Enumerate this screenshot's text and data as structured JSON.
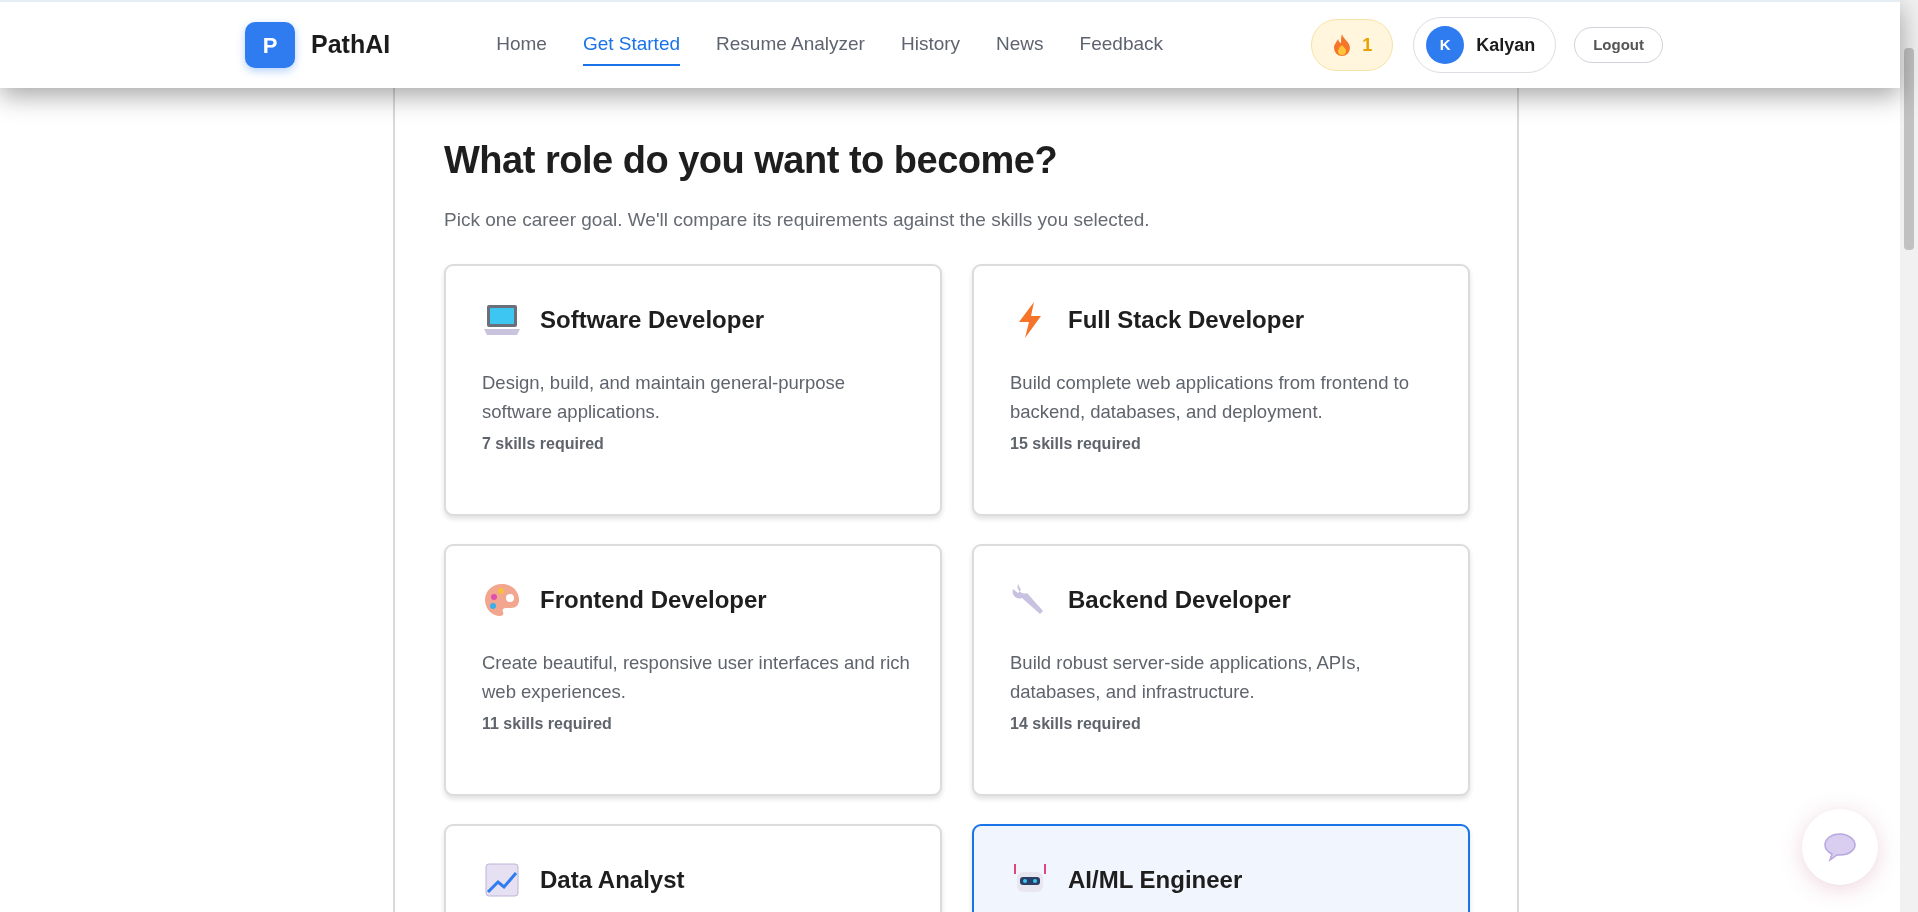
{
  "brand": {
    "logo_letter": "P",
    "name": "PathAI"
  },
  "nav": [
    {
      "label": "Home",
      "selected": false
    },
    {
      "label": "Get Started",
      "selected": true
    },
    {
      "label": "Resume Analyzer",
      "selected": false
    },
    {
      "label": "History",
      "selected": false
    },
    {
      "label": "News",
      "selected": false
    },
    {
      "label": "Feedback",
      "selected": false
    }
  ],
  "streak": {
    "count": "1"
  },
  "user": {
    "initial": "K",
    "name": "Kalyan"
  },
  "logout": "Logout",
  "heading": "What role do you want to become?",
  "subtitle": "Pick one career goal. We'll compare its requirements against the skills you selected.",
  "roles": [
    {
      "title": "Software Developer",
      "description": "Design, build, and maintain general-purpose software applications.",
      "skills": "7 skills required",
      "selected": false
    },
    {
      "title": "Full Stack Developer",
      "description": "Build complete web applications from frontend to backend, databases, and deployment.",
      "skills": "15 skills required",
      "selected": false
    },
    {
      "title": "Frontend Developer",
      "description": "Create beautiful, responsive user interfaces and rich web experiences.",
      "skills": "11 skills required",
      "selected": false
    },
    {
      "title": "Backend Developer",
      "description": "Build robust server-side applications, APIs, databases, and infrastructure.",
      "skills": "14 skills required",
      "selected": false
    },
    {
      "title": "Data Analyst",
      "selected": false
    },
    {
      "title": "AI/ML Engineer",
      "selected": true
    }
  ]
}
